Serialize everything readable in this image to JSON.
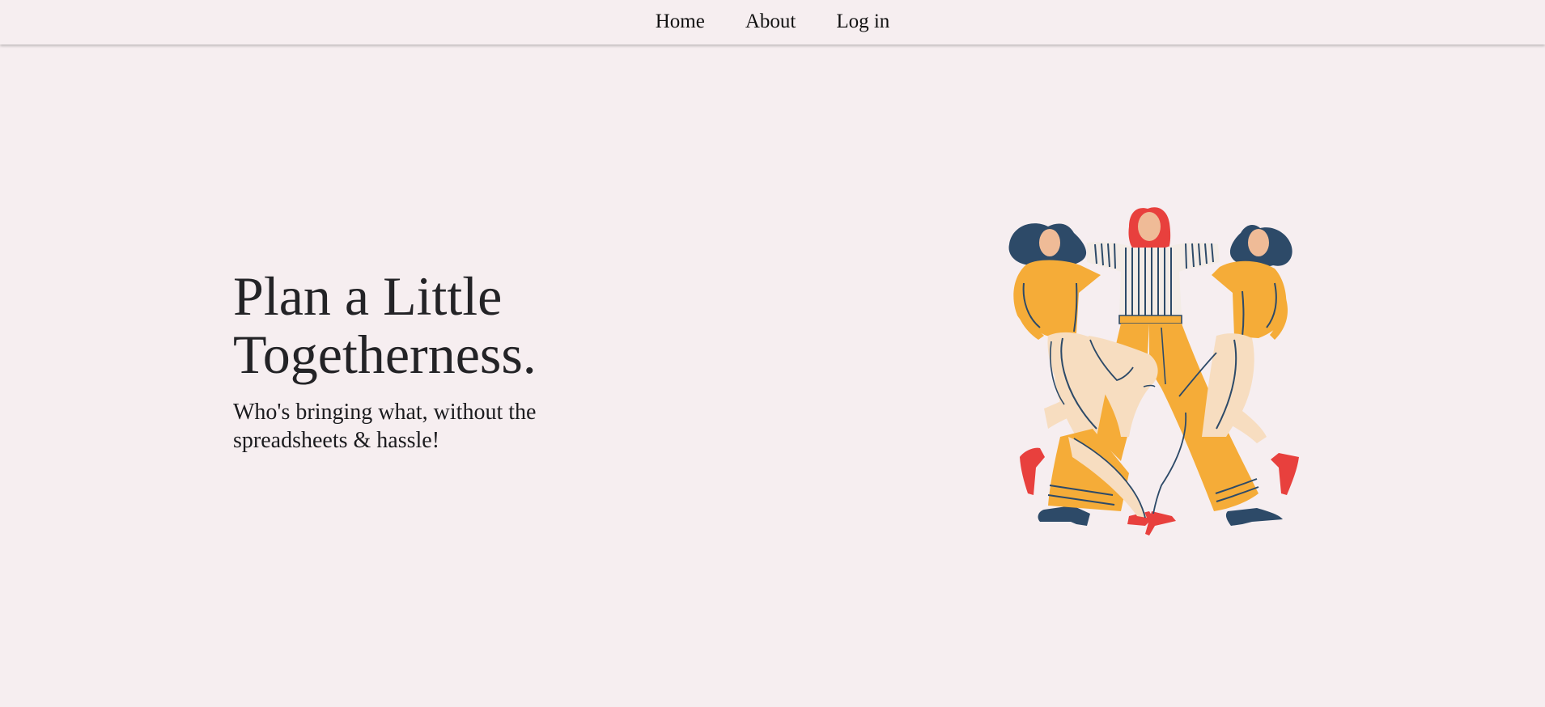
{
  "nav": {
    "home": "Home",
    "about": "About",
    "login": "Log in"
  },
  "hero": {
    "title_line1": "Plan a Little",
    "title_line2": "Togetherness.",
    "subtitle": "Who's bringing what, without the spreadsheets & hassle!"
  },
  "illustration": {
    "icon": "three-dancing-women-illustration"
  },
  "colors": {
    "background": "#f6eef0",
    "mustard": "#f5ac38",
    "navy": "#2d4a68",
    "red": "#e8403d",
    "skin": "#efbb97",
    "cream": "#f7ddc0"
  }
}
